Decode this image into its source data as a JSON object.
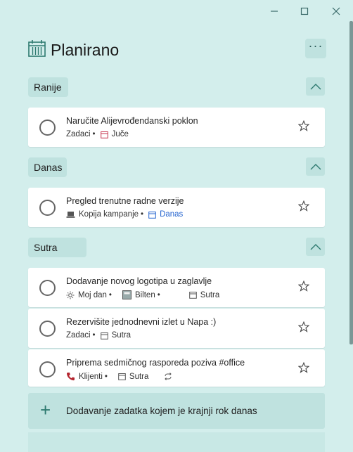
{
  "window": {
    "minimize_icon": "minimize-icon",
    "maximize_icon": "maximize-icon",
    "close_icon": "close-icon"
  },
  "header": {
    "icon": "calendar-grid-icon",
    "title": "Planirano",
    "more_label": "···"
  },
  "sections": [
    {
      "label": "Ranije",
      "tasks": [
        {
          "title": "Naručite Alijevrođendanski poklon",
          "list": "Zadaci",
          "due": "Juče",
          "due_color": "#c4314b"
        }
      ]
    },
    {
      "label": "Danas",
      "tasks": [
        {
          "title": "Pregled trenutne radne verzije",
          "list": "Kopija kampanje",
          "due": "Danas",
          "due_color": "#2564cf"
        }
      ]
    },
    {
      "label": "Sutra",
      "tasks": [
        {
          "title": "Dodavanje novog logotipa u zaglavlje",
          "list": "Moj dan",
          "extra": "Bilten",
          "due": "Sutra"
        },
        {
          "title": "Rezervišite jednodnevni izlet u Napa :)",
          "list": "Zadaci",
          "due": "Sutra"
        },
        {
          "title": "Priprema sedmičnog rasporeda poziva #office",
          "list": "Klijenti",
          "due": "Sutra",
          "repeat": true
        }
      ]
    }
  ],
  "separator": "•",
  "add_task": {
    "label": "Dodavanje zadatka kojem je krajnji rok danas",
    "plus": "+"
  },
  "colors": {
    "background": "#d3eeec",
    "accent": "#2e7a70",
    "overdue": "#c4314b",
    "today": "#2564cf"
  }
}
